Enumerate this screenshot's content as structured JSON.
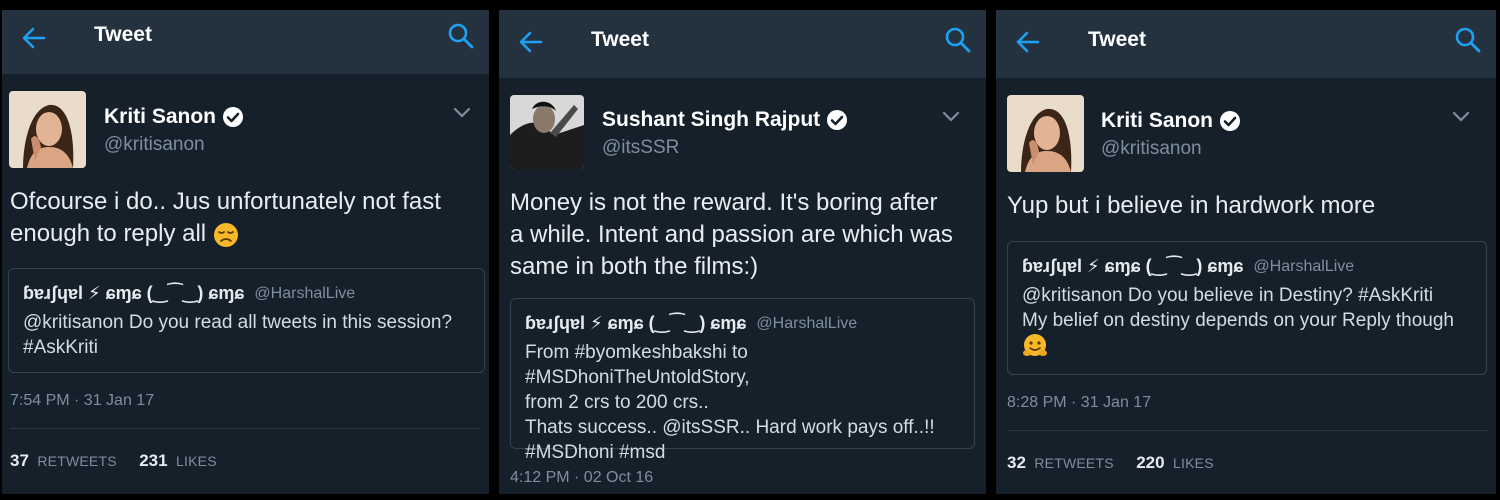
{
  "topbar": {
    "title": "Tweet"
  },
  "tweets": [
    {
      "author_name": "Kriti Sanon",
      "author_handle": "@kritisanon",
      "text": "Ofcourse i do.. Jus unfortunately not fast\nenough to reply all",
      "quote": {
        "name": "ɓɐɹʃɥɐl ⚡ ɕɱɕ (‿⁀‿) ɕɱɕ",
        "handle": "@HarshalLive",
        "text": "@kritisanon Do you read all tweets in this session?\n#AskKriti"
      },
      "timestamp": "7:54 PM · 31 Jan 17",
      "retweets": "37",
      "retweets_label": "RETWEETS",
      "likes": "231",
      "likes_label": "LIKES"
    },
    {
      "author_name": "Sushant Singh Rajput",
      "author_handle": "@itsSSR",
      "text": "Money is not the reward. It's boring after\na while. Intent and passion are which was\nsame in both the films:)",
      "quote": {
        "name": "ɓɐɹʃɥɐl ⚡ ɕɱɕ (‿⁀‿) ɕɱɕ",
        "handle": "@HarshalLive",
        "text": "From #byomkeshbakshi to #MSDhoniTheUntoldStory,\nfrom 2 crs to 200 crs..\nThats success.. @itsSSR.. Hard work pays off..!!\n#MSDhoni #msd"
      },
      "timestamp": "4:12 PM · 02 Oct 16"
    },
    {
      "author_name": "Kriti Sanon",
      "author_handle": "@kritisanon",
      "text": "Yup but i believe in hardwork more",
      "quote": {
        "name": "ɓɐɹʃɥɐl ⚡ ɕɱɕ (‿⁀‿) ɕɱɕ",
        "handle": "@HarshalLive",
        "text": "@kritisanon Do you believe in Destiny? #AskKriti\nMy belief on destiny depends on your Reply though"
      },
      "timestamp": "8:28 PM · 31 Jan 17",
      "retweets": "32",
      "retweets_label": "RETWEETS",
      "likes": "220",
      "likes_label": "LIKES"
    }
  ],
  "icons": {
    "back": "arrow-left-icon",
    "search": "search-icon",
    "verified": "verified-badge-icon",
    "menu": "chevron-down-icon",
    "emoji_1": "disappointed-face-emoji",
    "emoji_3": "hugging-face-emoji"
  },
  "colors": {
    "accent": "#1da1f2",
    "background": "#16202b",
    "topbar": "#24313f",
    "muted": "#7d8e9e"
  }
}
